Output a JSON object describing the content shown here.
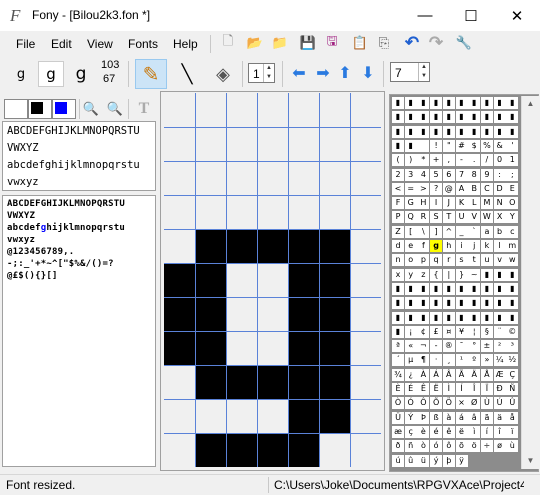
{
  "window": {
    "title": "Fony - [Bilou2k3.fon *]",
    "app_icon_glyph": "F",
    "minimize_glyph": "—",
    "maximize_glyph": "☐",
    "close_glyph": "✕"
  },
  "menu": {
    "file": "File",
    "edit": "Edit",
    "view": "View",
    "fonts": "Fonts",
    "help": "Help"
  },
  "toolbar1": [
    {
      "name": "new-file-icon",
      "glyph": "🗋"
    },
    {
      "name": "open-folder-icon",
      "glyph": "📂"
    },
    {
      "name": "open-recent-icon",
      "glyph": "📁"
    },
    {
      "name": "save-icon",
      "glyph": "💾"
    },
    {
      "name": "save-as-icon",
      "glyph": "🖫"
    },
    {
      "name": "paste-icon",
      "glyph": "📋"
    },
    {
      "name": "copy-icon",
      "glyph": "⎘"
    },
    {
      "name": "clipboard-icon",
      "glyph": "📋"
    },
    {
      "name": "undo-icon",
      "glyph": "↶"
    },
    {
      "name": "redo-icon",
      "glyph": "↷"
    },
    {
      "name": "wrench-icon",
      "glyph": "🔧"
    }
  ],
  "toolbar2": {
    "glyph_btn1": "g",
    "glyph_btn2": "g",
    "glyph_btn3": "g",
    "code_decimal": "103",
    "code_hex": "67",
    "pencil_glyph": "✎",
    "line_glyph": "╲",
    "fill_glyph": "◈",
    "zoom_value": "1",
    "arrow_left": "⬅",
    "arrow_right": "➡",
    "arrow_up": "⬆",
    "arrow_down": "⬇",
    "spacing_value": "7"
  },
  "preview_toolbar": {
    "zoom_out": "🔍",
    "zoom_in": "🔍",
    "text_tool": "T"
  },
  "preview": {
    "sample_lines": [
      "ABCDEFGHIJKLMNOPQRSTU",
      "VWXYZ",
      "abcdefghijklmnopqrstu",
      "vwxyz"
    ],
    "pixel_lines": [
      "ABCDEFGHIJKLMNOPQRSTU",
      "VWXYZ",
      "abcdefghijklmnopqrstu",
      "vwxyz",
      "@123456789,.",
      "-;:_'+*~^[\"$%&/()=?",
      "@£$(){}[]"
    ]
  },
  "editor": {
    "columns": 7,
    "rows": 11,
    "pixels": [
      "0000000",
      "0000000",
      "0000000",
      "0000000",
      "0111110",
      "1100110",
      "1100110",
      "1100110",
      "0111110",
      "0000110",
      "0111100"
    ]
  },
  "charmap": {
    "rows": [
      [
        "▮",
        "▮",
        "▮",
        "▮",
        "▮",
        "▮",
        "▮",
        "▮",
        "▮",
        "▮"
      ],
      [
        "▮",
        "▮",
        "▮",
        "▮",
        "▮",
        "▮",
        "▮",
        "▮",
        "▮",
        "▮"
      ],
      [
        "▮",
        "▮",
        "▮",
        "▮",
        "▮",
        "▮",
        "▮",
        "▮",
        "▮",
        "▮"
      ],
      [
        "▮",
        "▮",
        " ",
        "!",
        "\"",
        "#",
        "$",
        "%",
        "&",
        "'"
      ],
      [
        "(",
        ")",
        "*",
        "+",
        ",",
        "-",
        ".",
        "/",
        "0",
        "1"
      ],
      [
        "2",
        "3",
        "4",
        "5",
        "6",
        "7",
        "8",
        "9",
        ":",
        ";"
      ],
      [
        "<",
        "=",
        ">",
        "?",
        "@",
        "A",
        "B",
        "C",
        "D",
        "E"
      ],
      [
        "F",
        "G",
        "H",
        "I",
        "J",
        "K",
        "L",
        "M",
        "N",
        "O"
      ],
      [
        "P",
        "Q",
        "R",
        "S",
        "T",
        "U",
        "V",
        "W",
        "X",
        "Y"
      ],
      [
        "Z",
        "[",
        "\\",
        "]",
        "^",
        "_",
        "`",
        "a",
        "b",
        "c"
      ],
      [
        "d",
        "e",
        "f",
        "g",
        "h",
        "i",
        "j",
        "k",
        "l",
        "m"
      ],
      [
        "n",
        "o",
        "p",
        "q",
        "r",
        "s",
        "t",
        "u",
        "v",
        "w"
      ],
      [
        "x",
        "y",
        "z",
        "{",
        "|",
        "}",
        "~",
        "▮",
        "▮",
        "▮"
      ],
      [
        "▮",
        "▮",
        "▮",
        "▮",
        "▮",
        "▮",
        "▮",
        "▮",
        "▮",
        "▮"
      ],
      [
        "▮",
        "▮",
        "▮",
        "▮",
        "▮",
        "▮",
        "▮",
        "▮",
        "▮",
        "▮"
      ],
      [
        "▮",
        "▮",
        "▮",
        "▮",
        "▮",
        "▮",
        "▮",
        "▮",
        "▮",
        "▮"
      ],
      [
        "▮",
        "¡",
        "¢",
        "£",
        "¤",
        "¥",
        "¦",
        "§",
        "¨",
        "©"
      ],
      [
        "ª",
        "«",
        "¬",
        "-",
        "®",
        "¯",
        "°",
        "±",
        "²",
        "³"
      ],
      [
        "´",
        "µ",
        "¶",
        "·",
        "¸",
        "¹",
        "º",
        "»",
        "¼",
        "½"
      ],
      [
        "¾",
        "¿",
        "À",
        "Á",
        "Â",
        "Ã",
        "Ä",
        "Å",
        "Æ",
        "Ç"
      ],
      [
        "È",
        "É",
        "Ê",
        "Ë",
        "Ì",
        "Í",
        "Î",
        "Ï",
        "Ð",
        "Ñ"
      ],
      [
        "Ò",
        "Ó",
        "Ô",
        "Õ",
        "Ö",
        "×",
        "Ø",
        "Ù",
        "Ú",
        "Û"
      ],
      [
        "Ü",
        "Ý",
        "Þ",
        "ß",
        "à",
        "á",
        "â",
        "ã",
        "ä",
        "å"
      ],
      [
        "æ",
        "ç",
        "è",
        "é",
        "ê",
        "ë",
        "ì",
        "í",
        "î",
        "ï"
      ],
      [
        "ð",
        "ñ",
        "ò",
        "ó",
        "ô",
        "õ",
        "ö",
        "÷",
        "ø",
        "ù"
      ],
      [
        "ú",
        "û",
        "ü",
        "ý",
        "þ",
        "ÿ",
        "",
        "",
        "",
        ""
      ]
    ],
    "selected": "g"
  },
  "status": {
    "message": "Font resized.",
    "path": "C:\\Users\\Joke\\Documents\\RPGVXAce\\Project4\\"
  },
  "colors": {
    "grid_line": "#5a82d8",
    "pixel_on": "#000000",
    "highlight": "#ffff00",
    "foreground_swatch": "#000000",
    "background_swatch": "#ffffff",
    "selection_swatch": "#0000ff"
  }
}
